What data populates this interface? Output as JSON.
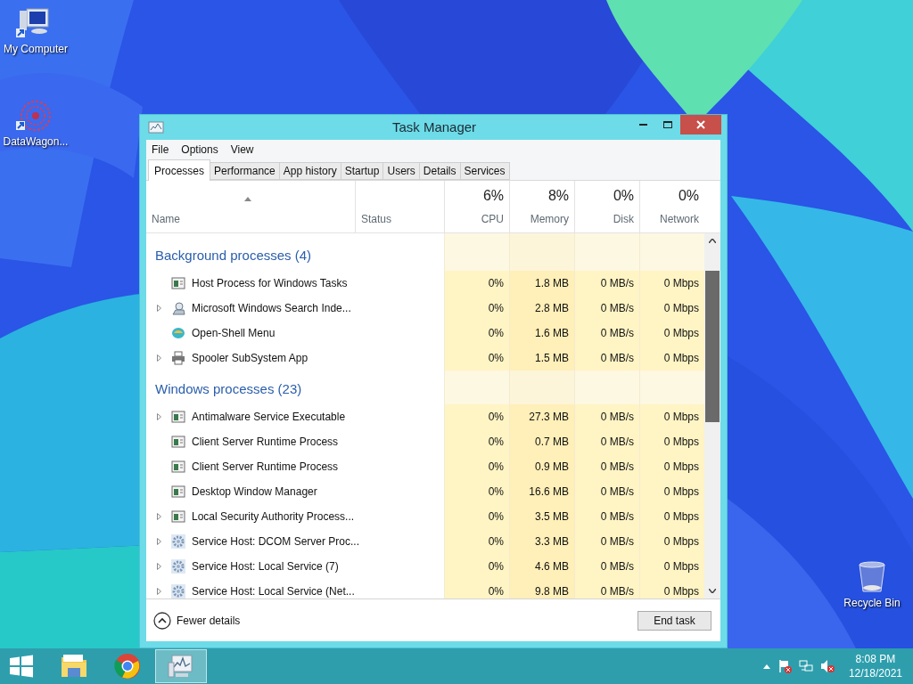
{
  "desktop_icons": [
    {
      "label": "My Computer",
      "kind": "computer"
    },
    {
      "label": "DataWagon...",
      "kind": "burst"
    },
    {
      "label": "Recycle Bin",
      "kind": "bin"
    }
  ],
  "window": {
    "title": "Task Manager",
    "menu": [
      "File",
      "Options",
      "View"
    ],
    "tabs": [
      {
        "label": "Processes",
        "selected": true
      },
      {
        "label": "Performance",
        "selected": false
      },
      {
        "label": "App history",
        "selected": false
      },
      {
        "label": "Startup",
        "selected": false
      },
      {
        "label": "Users",
        "selected": false
      },
      {
        "label": "Details",
        "selected": false
      },
      {
        "label": "Services",
        "selected": false
      }
    ],
    "columns": [
      {
        "label": "Name",
        "sorted": true
      },
      {
        "label": "Status"
      },
      {
        "label": "CPU",
        "total": "6%"
      },
      {
        "label": "Memory",
        "total": "8%"
      },
      {
        "label": "Disk",
        "total": "0%"
      },
      {
        "label": "Network",
        "total": "0%"
      }
    ],
    "groups": [
      {
        "title": "Background processes (4)",
        "rows": [
          {
            "name": "Host Process for Windows Tasks",
            "expandable": false,
            "kind": "app",
            "cpu": "0%",
            "memory": "1.8 MB",
            "disk": "0 MB/s",
            "network": "0 Mbps"
          },
          {
            "name": "Microsoft Windows Search Inde...",
            "expandable": true,
            "kind": "search",
            "cpu": "0%",
            "memory": "2.8 MB",
            "disk": "0 MB/s",
            "network": "0 Mbps"
          },
          {
            "name": "Open-Shell Menu",
            "expandable": false,
            "kind": "shell",
            "cpu": "0%",
            "memory": "1.6 MB",
            "disk": "0 MB/s",
            "network": "0 Mbps"
          },
          {
            "name": "Spooler SubSystem App",
            "expandable": true,
            "kind": "printer",
            "cpu": "0%",
            "memory": "1.5 MB",
            "disk": "0 MB/s",
            "network": "0 Mbps"
          }
        ]
      },
      {
        "title": "Windows processes (23)",
        "rows": [
          {
            "name": "Antimalware Service Executable",
            "expandable": true,
            "kind": "app",
            "cpu": "0%",
            "memory": "27.3 MB",
            "disk": "0 MB/s",
            "network": "0 Mbps"
          },
          {
            "name": "Client Server Runtime Process",
            "expandable": false,
            "kind": "app",
            "cpu": "0%",
            "memory": "0.7 MB",
            "disk": "0 MB/s",
            "network": "0 Mbps"
          },
          {
            "name": "Client Server Runtime Process",
            "expandable": false,
            "kind": "app",
            "cpu": "0%",
            "memory": "0.9 MB",
            "disk": "0 MB/s",
            "network": "0 Mbps"
          },
          {
            "name": "Desktop Window Manager",
            "expandable": false,
            "kind": "app",
            "cpu": "0%",
            "memory": "16.6 MB",
            "disk": "0 MB/s",
            "network": "0 Mbps"
          },
          {
            "name": "Local Security Authority Process...",
            "expandable": true,
            "kind": "app",
            "cpu": "0%",
            "memory": "3.5 MB",
            "disk": "0 MB/s",
            "network": "0 Mbps"
          },
          {
            "name": "Service Host: DCOM Server Proc...",
            "expandable": true,
            "kind": "gear",
            "cpu": "0%",
            "memory": "3.3 MB",
            "disk": "0 MB/s",
            "network": "0 Mbps"
          },
          {
            "name": "Service Host: Local Service (7)",
            "expandable": true,
            "kind": "gear",
            "cpu": "0%",
            "memory": "4.6 MB",
            "disk": "0 MB/s",
            "network": "0 Mbps"
          },
          {
            "name": "Service Host: Local Service (Net...",
            "expandable": true,
            "kind": "gear",
            "cpu": "0%",
            "memory": "9.8 MB",
            "disk": "0 MB/s",
            "network": "0 Mbps"
          }
        ]
      }
    ],
    "footer": {
      "details_link": "Fewer details",
      "button": "End task"
    }
  },
  "taskbar": {
    "apps": [
      {
        "kind": "folder",
        "selected": false
      },
      {
        "kind": "browser",
        "selected": false
      },
      {
        "kind": "monitor",
        "selected": true
      }
    ],
    "time": "8:08 PM",
    "date": "12/18/2021"
  }
}
